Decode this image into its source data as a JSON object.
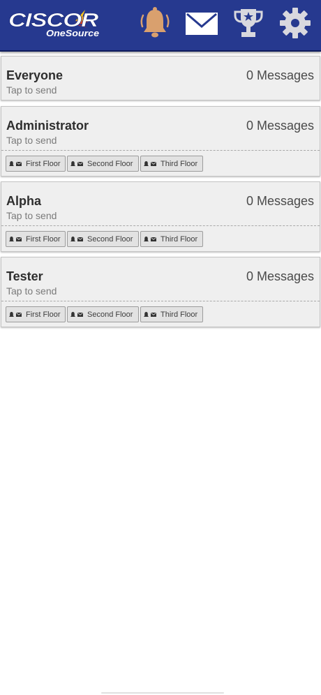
{
  "app": {
    "logo_text": "CISCOR",
    "logo_subtext": "OneSource"
  },
  "header": {
    "icons": [
      "bell-icon",
      "mail-icon",
      "trophy-icon",
      "gear-icon"
    ],
    "colors": {
      "bar": "#26398f",
      "bell": "#d9a06e",
      "icons": "#ffffff"
    }
  },
  "groups": [
    {
      "name": "Everyone",
      "subtitle": "Tap to send",
      "count": "0",
      "count_label": "Messages",
      "zones": []
    },
    {
      "name": "Administrator",
      "subtitle": "Tap to send",
      "count": "0",
      "count_label": "Messages",
      "zones": [
        {
          "label": "First Floor"
        },
        {
          "label": "Second Floor"
        },
        {
          "label": "Third Floor"
        }
      ]
    },
    {
      "name": "Alpha",
      "subtitle": "Tap to send",
      "count": "0",
      "count_label": "Messages",
      "zones": [
        {
          "label": "First Floor"
        },
        {
          "label": "Second Floor"
        },
        {
          "label": "Third Floor"
        }
      ]
    },
    {
      "name": "Tester",
      "subtitle": "Tap to send",
      "count": "0",
      "count_label": "Messages",
      "zones": [
        {
          "label": "First Floor"
        },
        {
          "label": "Second Floor"
        },
        {
          "label": "Third Floor"
        }
      ]
    }
  ]
}
